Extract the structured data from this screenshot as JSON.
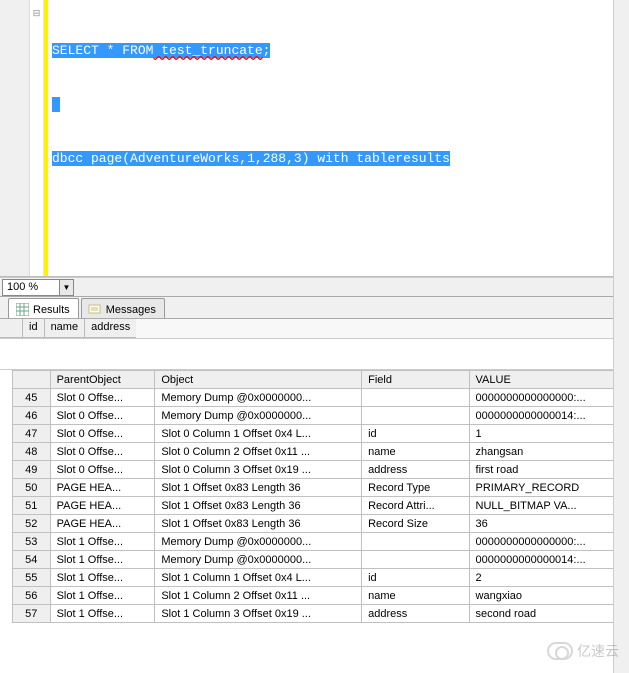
{
  "editor": {
    "line1_kw1": "SELECT",
    "line1_star": " * ",
    "line1_kw2": "FROM",
    "line1_ident": " test_truncate",
    "line1_semi": ";",
    "line2": "",
    "line3_fn": "dbcc page",
    "line3_paren_open": "(",
    "line3_arg1": "AdventureWorks",
    "line3_comma1": ",",
    "line3_arg2": "1",
    "line3_comma2": ",",
    "line3_arg3": "288",
    "line3_comma3": ",",
    "line3_arg4": "3",
    "line3_paren_close": ") ",
    "line3_kw3": "with",
    "line3_tail": " tableresults"
  },
  "zoom": {
    "value": "100 %"
  },
  "tabs": {
    "results_label": "Results",
    "messages_label": "Messages"
  },
  "mini_headers": {
    "c1": "id",
    "c2": "name",
    "c3": "address"
  },
  "grid": {
    "headers": {
      "parent": "ParentObject",
      "object": "Object",
      "field": "Field",
      "value": "VALUE"
    },
    "rows": [
      {
        "n": "45",
        "parent": "Slot 0 Offse...",
        "object": "Memory Dump @0x0000000...",
        "field": "",
        "value": "0000000000000000:..."
      },
      {
        "n": "46",
        "parent": "Slot 0 Offse...",
        "object": "Memory Dump @0x0000000...",
        "field": "",
        "value": "0000000000000014:..."
      },
      {
        "n": "47",
        "parent": "Slot 0 Offse...",
        "object": "Slot 0 Column 1 Offset 0x4 L...",
        "field": "id",
        "value": "1"
      },
      {
        "n": "48",
        "parent": "Slot 0 Offse...",
        "object": "Slot 0 Column 2 Offset 0x11 ...",
        "field": "name",
        "value": "zhangsan"
      },
      {
        "n": "49",
        "parent": "Slot 0 Offse...",
        "object": "Slot 0 Column 3 Offset 0x19 ...",
        "field": "address",
        "value": "first road"
      },
      {
        "n": "50",
        "parent": "PAGE HEA...",
        "object": "Slot 1 Offset 0x83 Length 36",
        "field": "Record Type",
        "value": "PRIMARY_RECORD"
      },
      {
        "n": "51",
        "parent": "PAGE HEA...",
        "object": "Slot 1 Offset 0x83 Length 36",
        "field": "Record Attri...",
        "value": " NULL_BITMAP VA..."
      },
      {
        "n": "52",
        "parent": "PAGE HEA...",
        "object": "Slot 1 Offset 0x83 Length 36",
        "field": "Record Size",
        "value": "36"
      },
      {
        "n": "53",
        "parent": "Slot 1 Offse...",
        "object": "Memory Dump @0x0000000...",
        "field": "",
        "value": "0000000000000000:..."
      },
      {
        "n": "54",
        "parent": "Slot 1 Offse...",
        "object": "Memory Dump @0x0000000...",
        "field": "",
        "value": "0000000000000014:..."
      },
      {
        "n": "55",
        "parent": "Slot 1 Offse...",
        "object": "Slot 1 Column 1 Offset 0x4 L...",
        "field": "id",
        "value": "2"
      },
      {
        "n": "56",
        "parent": "Slot 1 Offse...",
        "object": "Slot 1 Column 2 Offset 0x11 ...",
        "field": "name",
        "value": "wangxiao"
      },
      {
        "n": "57",
        "parent": "Slot 1 Offse...",
        "object": "Slot 1 Column 3 Offset 0x19 ...",
        "field": "address",
        "value": "second road"
      }
    ]
  },
  "watermark": "亿速云"
}
